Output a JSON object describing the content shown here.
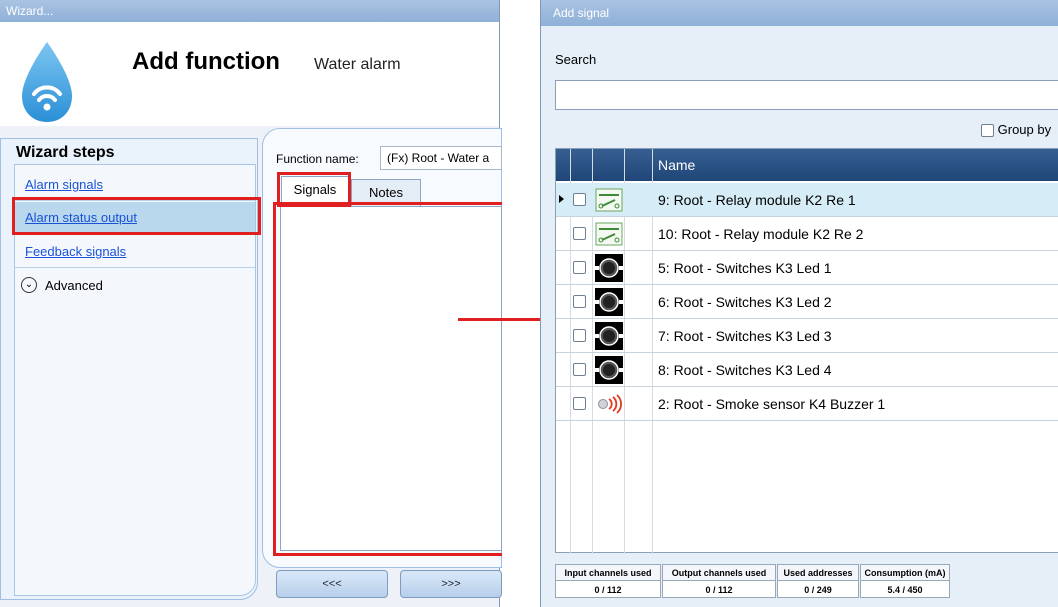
{
  "wizard": {
    "window_title": "Wizard...",
    "title": "Add function",
    "subtitle": "Water alarm",
    "steps_heading": "Wizard steps",
    "steps": [
      {
        "label": "Alarm signals"
      },
      {
        "label": "Alarm status output",
        "selected": true
      },
      {
        "label": "Feedback signals"
      }
    ],
    "advanced_label": "Advanced",
    "function_name_label": "Function name:",
    "function_name_value": "(Fx) Root - Water a",
    "tabs": [
      {
        "label": "Signals",
        "selected": true
      },
      {
        "label": "Notes"
      }
    ],
    "prev_button": "<<<",
    "next_button": ">>>"
  },
  "add_signal": {
    "window_title": "Add signal",
    "search_label": "Search",
    "search_value": "",
    "group_by_label": "Group by",
    "column_name": "Name",
    "rows": [
      {
        "name": "9: Root - Relay module K2 Re 1",
        "icon": "relay-icon",
        "selected": true
      },
      {
        "name": "10: Root - Relay module K2 Re 2",
        "icon": "relay-icon"
      },
      {
        "name": "5: Root - Switches K3 Led 1",
        "icon": "switch-led-icon"
      },
      {
        "name": "6: Root - Switches K3 Led 2",
        "icon": "switch-led-icon"
      },
      {
        "name": "7: Root - Switches K3 Led 3",
        "icon": "switch-led-icon"
      },
      {
        "name": "8: Root - Switches K3 Led 4",
        "icon": "switch-led-icon"
      },
      {
        "name": "2: Root - Smoke sensor K4 Buzzer 1",
        "icon": "buzzer-icon"
      }
    ],
    "stats": [
      {
        "label": "Input channels used",
        "value": "0 / 112"
      },
      {
        "label": "Output channels used",
        "value": "0 / 112"
      },
      {
        "label": "Used addresses",
        "value": "0 / 249"
      },
      {
        "label": "Consumption (mA)",
        "value": "5.4 / 450"
      }
    ]
  },
  "colors": {
    "highlight_red": "#e02020",
    "grid_header": "#1f4677",
    "link": "#1a52d6",
    "selected_row": "#d6ecf6"
  }
}
